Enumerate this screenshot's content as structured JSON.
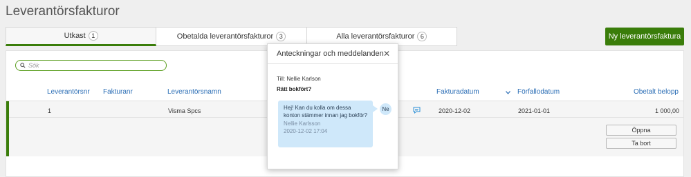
{
  "page": {
    "title": "Leverantörsfakturor"
  },
  "tabs": [
    {
      "label": "Utkast",
      "count": "1"
    },
    {
      "label": "Obetalda leverantörsfakturor",
      "count": "3"
    },
    {
      "label": "Alla leverantörsfakturor",
      "count": "6"
    }
  ],
  "actions": {
    "new_invoice": "Ny leverantörsfaktura"
  },
  "search": {
    "placeholder": "Sök",
    "value": ""
  },
  "table": {
    "columns": {
      "supplier_no": "Leverantörsnr",
      "invoice_no": "Fakturanr",
      "supplier_name": "Leverantörsnamn",
      "invoice_date": "Fakturadatum",
      "due_date": "Förfallodatum",
      "unpaid_amount": "Obetalt belopp"
    },
    "rows": [
      {
        "supplier_no": "1",
        "invoice_no": "",
        "supplier_name": "Visma Spcs",
        "invoice_date": "2020-12-02",
        "due_date": "2021-01-01",
        "unpaid_amount": "1 000,00",
        "open_label": "Öppna",
        "delete_label": "Ta bort"
      }
    ]
  },
  "popup": {
    "title": "Anteckningar och meddelanden",
    "to": "Till: Nellie Karlson",
    "subject": "Rätt bokfört?",
    "message": {
      "text": "Hej! Kan du kolla om dessa konton stämmer innan jag bokför?",
      "author": "Nellie Karlsson",
      "timestamp": "2020-12-02 17:04",
      "avatar": "Ne"
    }
  },
  "colors": {
    "accent": "#3a7d0a",
    "link": "#2a6db5",
    "bubble": "#cfe8fa"
  }
}
